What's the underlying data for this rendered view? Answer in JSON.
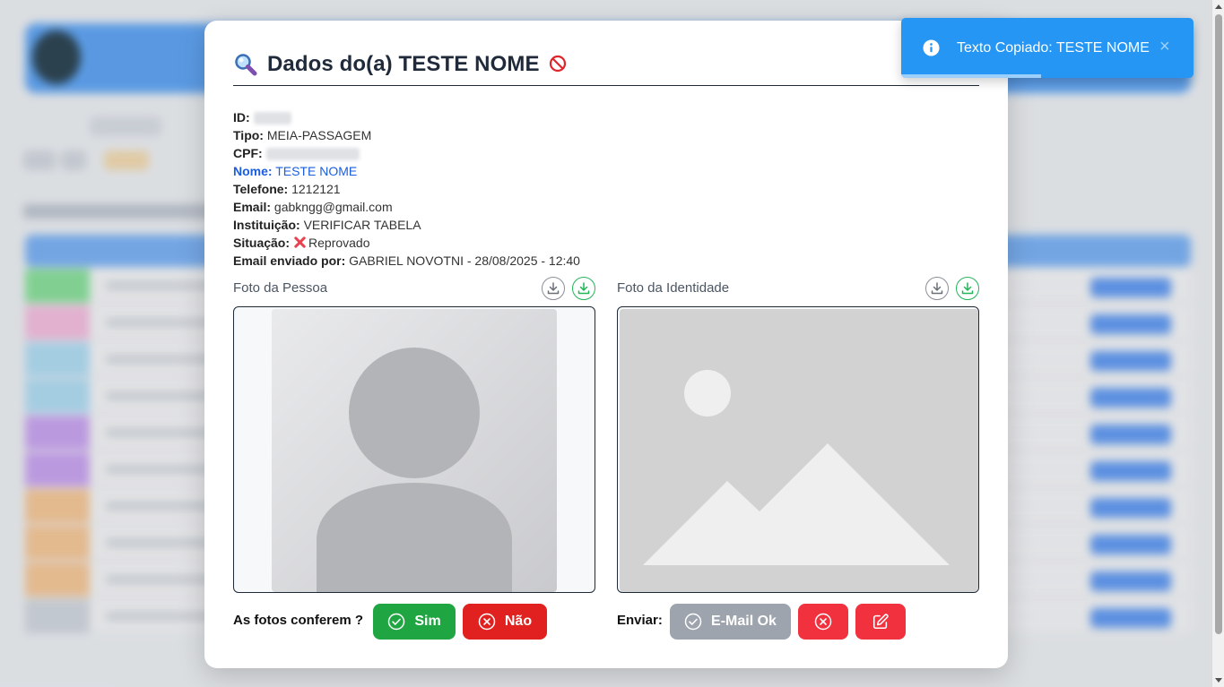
{
  "modal": {
    "title": "Dados do(a) TESTE NOME",
    "fields": [
      {
        "label": "ID:",
        "value": ""
      },
      {
        "label": "Tipo:",
        "value": "MEIA-PASSAGEM"
      },
      {
        "label": "CPF:",
        "value": ""
      },
      {
        "label": "Nome:",
        "value": "TESTE NOME"
      },
      {
        "label": "Telefone:",
        "value": "1212121"
      },
      {
        "label": "Email:",
        "value": "gabkngg@gmail.com"
      },
      {
        "label": "Instituição:",
        "value": "VERIFICAR TABELA"
      },
      {
        "label": "Situação:",
        "value": "Reprovado",
        "icon": "red-x-icon"
      },
      {
        "label": "Email enviado por:",
        "value": "GABRIEL NOVOTNI - 28/08/2025 - 12:40"
      }
    ],
    "photos": {
      "person_label": "Foto da Pessoa",
      "identity_label": "Foto da Identidade"
    },
    "actions": {
      "confirm_label": "As fotos conferem ?",
      "yes_label": "Sim",
      "no_label": "Não",
      "send_label": "Enviar:",
      "email_ok_label": "E-Mail Ok"
    }
  },
  "toast": {
    "message": "Texto Copiado: TESTE NOME",
    "close_glyph": "×",
    "progress_fraction": 0.48
  },
  "colors": {
    "success": "#1fa643",
    "danger": "#e0211f",
    "toast": "#2596f3",
    "highlight": "#1a5dde"
  }
}
